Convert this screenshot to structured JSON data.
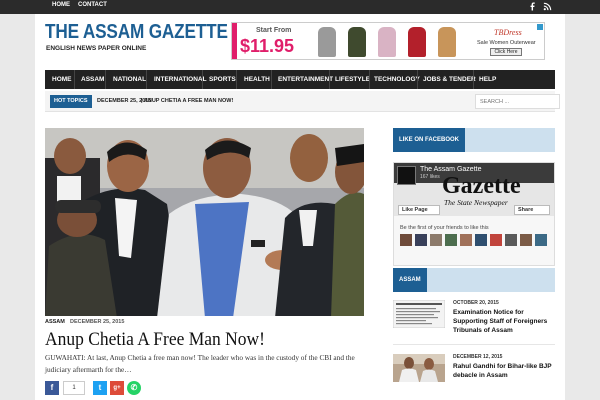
{
  "topbar": {
    "links": [
      "HOME",
      "CONTACT"
    ],
    "icons": [
      "facebook-icon",
      "rss-icon"
    ]
  },
  "header": {
    "title": "THE ASSAM GAZETTE",
    "subtitle": "ENGLISH NEWS PAPER ONLINE"
  },
  "ad": {
    "start_label": "Start From",
    "price": "$11.95",
    "brand": "TBDress",
    "tagline": "Sale Women Outerwear",
    "button": "Click Here",
    "accent": "#e01e6a"
  },
  "nav": {
    "items": [
      "HOME",
      "ASSAM",
      "NATIONAL",
      "INTERNATIONAL",
      "SPORTS",
      "HEALTH",
      "ENTERTAINMENT",
      "LIFESTYLE",
      "TECHNOLOGY",
      "JOBS & TENDER",
      "HELP"
    ]
  },
  "ticker": {
    "label": "HOT TOPICS",
    "date": "DECEMBER 25, 2015",
    "separator": "|",
    "headline": "ANUP CHETIA A FREE MAN NOW!",
    "search_placeholder": "SEARCH ..."
  },
  "featured": {
    "category": "ASSAM",
    "date": "DECEMBER 25, 2015",
    "title": "Anup Chetia A Free Man Now!",
    "excerpt": "GUWAHATI: At last, Anup Chetia a free man now! The leader who was in the custody of the CBI and the judiciary aftermarth for the…",
    "share_count": "1"
  },
  "sidebar": {
    "facebook_title": "LIKE ON FACEBOOK",
    "fb": {
      "page_name": "The Assam Gazette",
      "likes": "167 likes",
      "cover_title": "Gazette",
      "cover_subtitle": "The State Newspaper",
      "like_button": "Like Page",
      "share_button": "Share",
      "friends_text": "Be the first of your friends to like this"
    },
    "assam_title": "ASSAM",
    "news": [
      {
        "date": "OCTOBER 20, 2015",
        "title": "Examination Notice for Supporting Staff of Foreigners Tribunals of Assam"
      },
      {
        "date": "DECEMBER 12, 2015",
        "title": "Rahul Gandhi for Bihar-like BJP debacle in Assam"
      }
    ]
  },
  "colors": {
    "brand_blue": "#1d5f93",
    "nav_bg": "#222222",
    "widget_bg": "#cde0ee"
  }
}
